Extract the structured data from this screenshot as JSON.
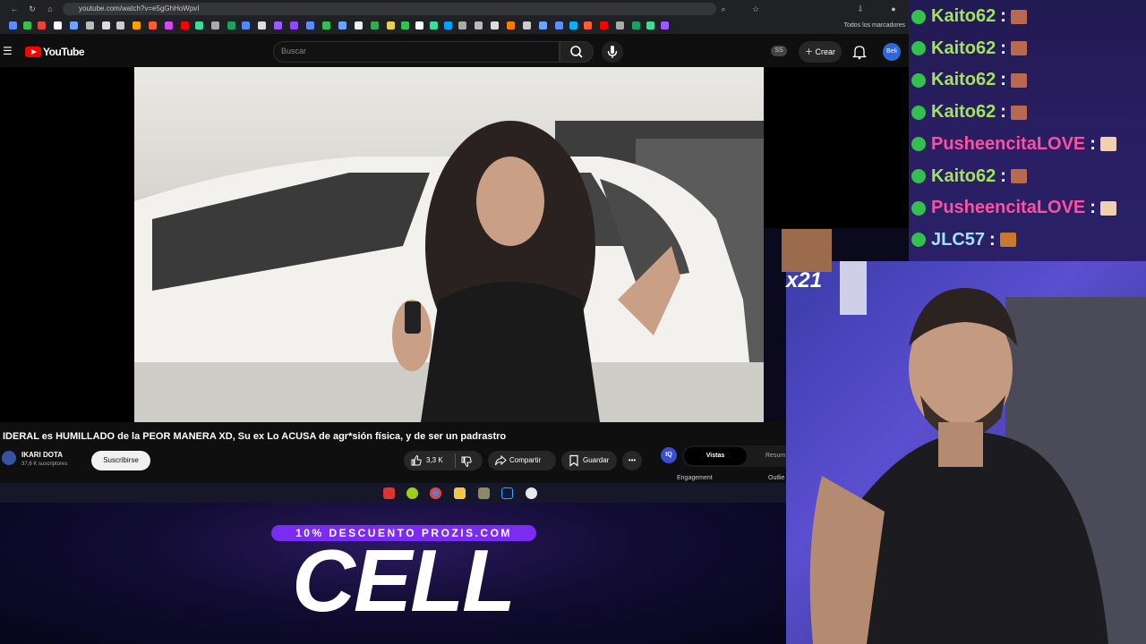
{
  "browser": {
    "url": "youtube.com/watch?v=e5gGhHoWpvI",
    "bookmarks_folder": "Todos los marcadores"
  },
  "youtube": {
    "logo_text": "YouTube",
    "search_placeholder": "Buscar",
    "ss_badge": "SS",
    "create_label": "Crear",
    "avatar_text": "Beli"
  },
  "video": {
    "title": "IDERAL es HUMILLADO de la PEOR MANERA XD, Su ex Lo ACUSA de agr*sión física, y de ser un padrastro",
    "channel_name": "IKARI DOTA",
    "subscribers": "37,6 K suscriptores",
    "subscribe_label": "Suscribirse",
    "like_count": "3,3 K",
    "share_label": "Compartir",
    "save_label": "Guardar",
    "more_label": "•••"
  },
  "side_panel": {
    "icon_text": "IQ",
    "tab_active": "Vistas",
    "tab_other": "Resum",
    "label_engagement": "Engagement",
    "label_outlier": "Outlie"
  },
  "overlay": {
    "discount_banner": "10% DESCUENTO PROZIS.COM",
    "big_code": "CELL",
    "emote_count": "x21"
  },
  "chat": {
    "messages": [
      {
        "user": "Kaito62",
        "color": "#a3e35a",
        "emote": "face-emote"
      },
      {
        "user": "Kaito62",
        "color": "#a3e35a",
        "emote": "face-emote"
      },
      {
        "user": "Kaito62",
        "color": "#a3e35a",
        "emote": "face-emote"
      },
      {
        "user": "Kaito62",
        "color": "#a3e35a",
        "emote": "face-emote"
      },
      {
        "user": "PusheencitaLOVE",
        "color": "#ff4fa3",
        "emote": "thumb-emote"
      },
      {
        "user": "Kaito62",
        "color": "#a3e35a",
        "emote": "face-emote"
      },
      {
        "user": "PusheencitaLOVE",
        "color": "#ff4fa3",
        "emote": "thumb-emote"
      },
      {
        "user": "JLC57",
        "color": "#9fe3ff",
        "emote": "violin-emote"
      }
    ],
    "separator": ":"
  }
}
